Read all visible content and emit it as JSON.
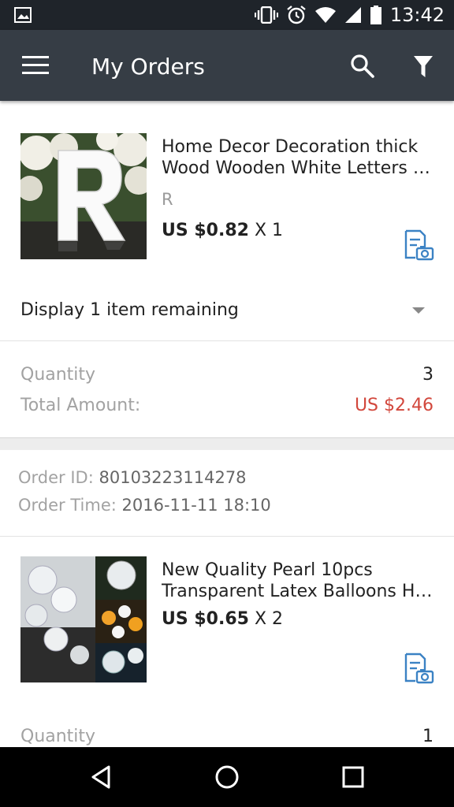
{
  "status_bar": {
    "time": "13:42",
    "icons": [
      "image-icon",
      "vibrate-icon",
      "alarm-icon",
      "wifi-icon",
      "signal-icon",
      "battery-icon"
    ]
  },
  "app_bar": {
    "title": "My Orders",
    "icons": [
      "menu-icon",
      "search-icon",
      "filter-icon"
    ]
  },
  "orders": [
    {
      "product": {
        "name_line1": "Home Decor Decoration thick",
        "name_line2": "Wood Wooden White Letters A…",
        "variant": "R",
        "price": "US $0.82",
        "qty_text": "X 1"
      },
      "remaining_text": "Display 1 item remaining",
      "quantity_label": "Quantity",
      "quantity_value": "3",
      "total_label": "Total Amount:",
      "total_value": "US $2.46"
    },
    {
      "order_id_label": "Order ID:",
      "order_id_value": "80103223114278",
      "order_time_label": "Order Time:",
      "order_time_value": "2016-11-11 18:10",
      "product": {
        "name_line1": "New Quality Pearl 10pcs",
        "name_line2": "Transparent Latex Balloons Ho…",
        "price": "US $0.65",
        "qty_text": "X 2"
      },
      "quantity_label": "Quantity",
      "quantity_value": "1"
    }
  ],
  "colors": {
    "status_bar": "#1f242a",
    "app_bar": "#363d45",
    "accent_red": "#d2473c",
    "icon_blue": "#3b82c4"
  }
}
